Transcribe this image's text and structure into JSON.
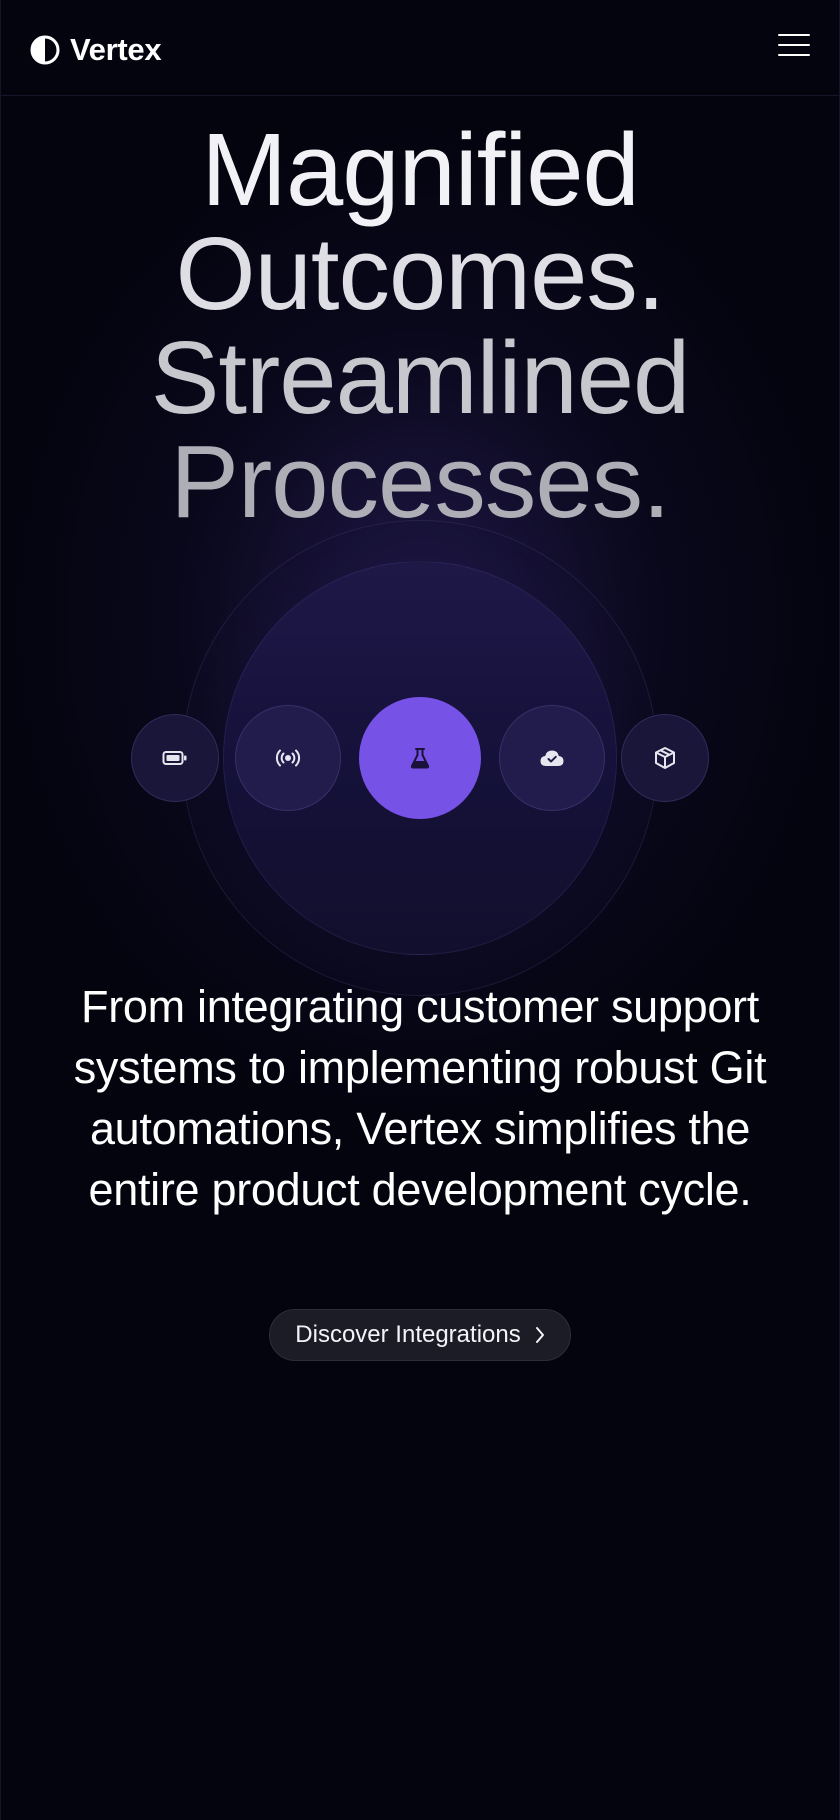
{
  "header": {
    "brand_name": "Vertex",
    "logo_icon": "half-circle-logo-icon",
    "menu_icon": "hamburger-menu-icon"
  },
  "hero": {
    "headline_lines": [
      "Magnified",
      "Outcomes.",
      "Streamlined",
      "Processes."
    ]
  },
  "orbit": {
    "nodes": [
      {
        "icon": "battery-icon",
        "state": "inactive"
      },
      {
        "icon": "broadcast-icon",
        "state": "inactive"
      },
      {
        "icon": "flask-icon",
        "state": "active"
      },
      {
        "icon": "cloud-check-icon",
        "state": "inactive"
      },
      {
        "icon": "cube-icon",
        "state": "inactive"
      }
    ]
  },
  "description": "From integrating customer support systems to implementing robust Git automations, Vertex simplifies the entire product development cycle.",
  "cta": {
    "label": "Discover Integrations",
    "icon": "chevron-right-icon"
  },
  "colors": {
    "background": "#04040f",
    "accent": "#7752e6",
    "button_bg": "#1c1c26"
  }
}
